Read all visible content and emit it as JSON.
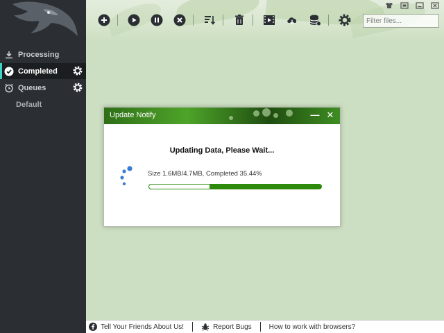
{
  "sidebar": {
    "items": [
      {
        "label": "Processing",
        "icon": "download-icon"
      },
      {
        "label": "Completed",
        "icon": "check-circle-icon",
        "active": true
      },
      {
        "label": "Queues",
        "icon": "alarm-clock-icon"
      },
      {
        "label": "Default"
      }
    ]
  },
  "toolbar": {
    "buttons": [
      "add-icon",
      "play-icon",
      "pause-icon",
      "stop-icon",
      "sort-icon",
      "delete-icon",
      "video-icon",
      "cloud-download-icon",
      "database-icon",
      "settings-icon"
    ]
  },
  "search": {
    "placeholder": "Filter files..."
  },
  "dialog": {
    "title": "Update Notify",
    "heading": "Updating Data, Please Wait...",
    "status": "Size 1.6MB/4.7MB, Completed 35.44%",
    "progress_fraction": 0.3544,
    "minimize": "—",
    "close": "✕"
  },
  "footer": {
    "share": "Tell Your Friends About Us!",
    "bugs": "Report Bugs",
    "browsers": "How to work with browsers?"
  },
  "colors": {
    "sidebar_bg": "#2b2f33",
    "active_accent": "#3fd1c4",
    "progress_green": "#2d8a0c",
    "spinner_blue": "#3a7bd5"
  }
}
